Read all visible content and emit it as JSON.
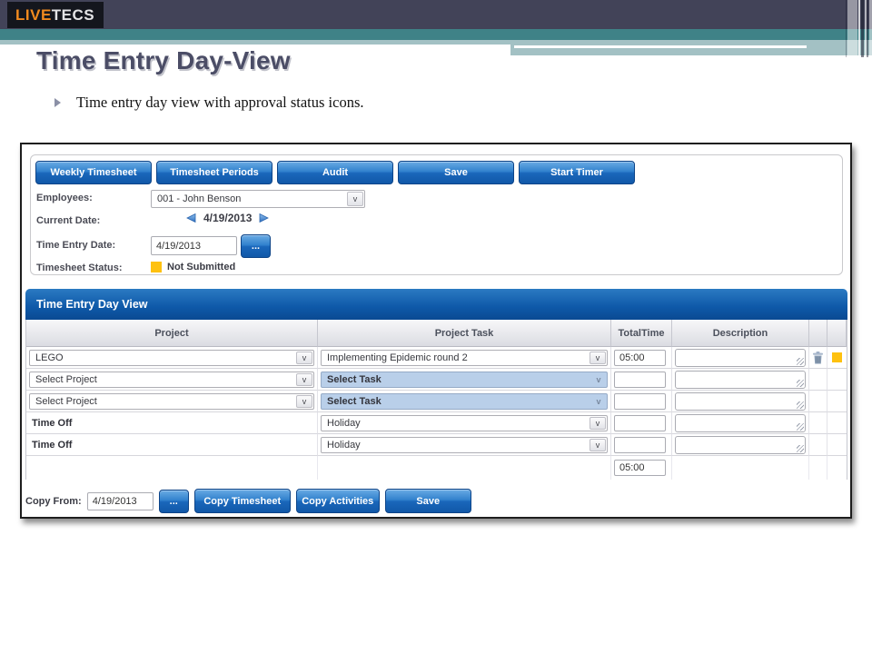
{
  "header": {
    "logo_live": "LIVE",
    "logo_tecs": "TECS"
  },
  "slide": {
    "title": "Time Entry Day-View",
    "bullet_text": "Time entry day view with approval status icons."
  },
  "app": {
    "toolbar_buttons": [
      "Weekly Timesheet",
      "Timesheet Periods",
      "Audit",
      "Save",
      "Start Timer"
    ],
    "form": {
      "employees_label": "Employees:",
      "employees_value": "001 - John Benson",
      "current_date_label": "Current Date:",
      "current_date_value": "4/19/2013",
      "time_entry_date_label": "Time Entry Date:",
      "time_entry_date_value": "4/19/2013",
      "browse_label": "...",
      "status_label": "Timesheet Status:",
      "status_value": "Not Submitted"
    },
    "panel": {
      "title": "Time Entry Day View",
      "columns": {
        "project": "Project",
        "task": "Project Task",
        "total_time": "TotalTime",
        "description": "Description"
      },
      "rows": [
        {
          "project": "LEGO",
          "task": "Implementing Epidemic round 2",
          "total_time": "05:00",
          "description": ""
        },
        {
          "project": "Select Project",
          "task": "Select Task",
          "total_time": "",
          "description": ""
        },
        {
          "project": "Select Project",
          "task": "Select Task",
          "total_time": "",
          "description": ""
        },
        {
          "project": "Time Off",
          "task": "Holiday",
          "total_time": "",
          "description": ""
        },
        {
          "project": "Time Off",
          "task": "Holiday",
          "total_time": "",
          "description": ""
        }
      ],
      "total_row": {
        "total_time": "05:00"
      }
    },
    "footer": {
      "copy_from_label": "Copy From:",
      "copy_from_value": "4/19/2013",
      "browse_label": "...",
      "buttons": [
        "Copy Timesheet",
        "Copy Activities",
        "Save"
      ]
    },
    "colors": {
      "accent_blue": "#1563b0",
      "status_yellow": "#fec110",
      "teal": "#3f8287",
      "light_teal": "#a3c1c4",
      "dark_slate": "#424358"
    }
  }
}
